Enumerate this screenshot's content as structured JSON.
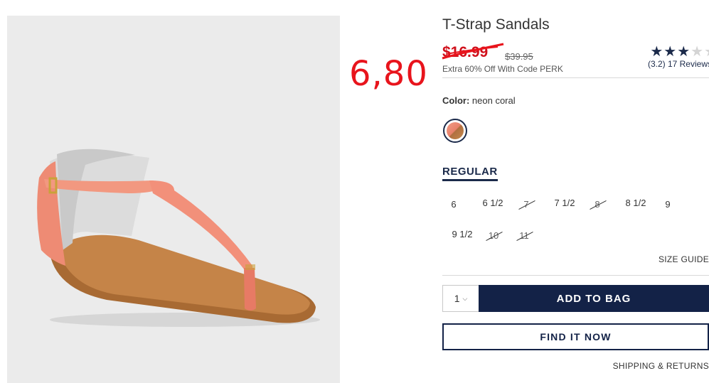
{
  "annotation": {
    "handwritten_price": "6,80"
  },
  "product": {
    "title": "T-Strap Sandals",
    "sale_price": "$16.99",
    "original_price": "$39.95",
    "promo_text": "Extra 60% Off With Code PERK",
    "rating": {
      "value": 3.2,
      "stars_full": 3,
      "stars_total": 5,
      "reviews_text": "(3.2) 17 Reviews"
    }
  },
  "color": {
    "label": "Color:",
    "value": "neon coral",
    "swatch_colors": [
      "#e8826a",
      "#b07040"
    ]
  },
  "fit": {
    "tab_label": "REGULAR"
  },
  "sizes": [
    {
      "label": "6",
      "available": true
    },
    {
      "label": "6 1/2",
      "available": true
    },
    {
      "label": "7",
      "available": false
    },
    {
      "label": "7 1/2",
      "available": true
    },
    {
      "label": "8",
      "available": false
    },
    {
      "label": "8 1/2",
      "available": true
    },
    {
      "label": "9",
      "available": true
    },
    {
      "label": "9 1/2",
      "available": true
    },
    {
      "label": "10",
      "available": false
    },
    {
      "label": "11",
      "available": false
    }
  ],
  "size_guide": "SIZE GUIDE",
  "quantity": {
    "value": "1",
    "icon": "chevron-down-icon"
  },
  "buttons": {
    "add_to_bag": "ADD TO BAG",
    "find_it_now": "FIND IT NOW"
  },
  "shipping_link": "SHIPPING & RETURNS",
  "colors": {
    "navy": "#132247",
    "sale_red": "#d0101b",
    "annotation_red": "#e8141c"
  }
}
